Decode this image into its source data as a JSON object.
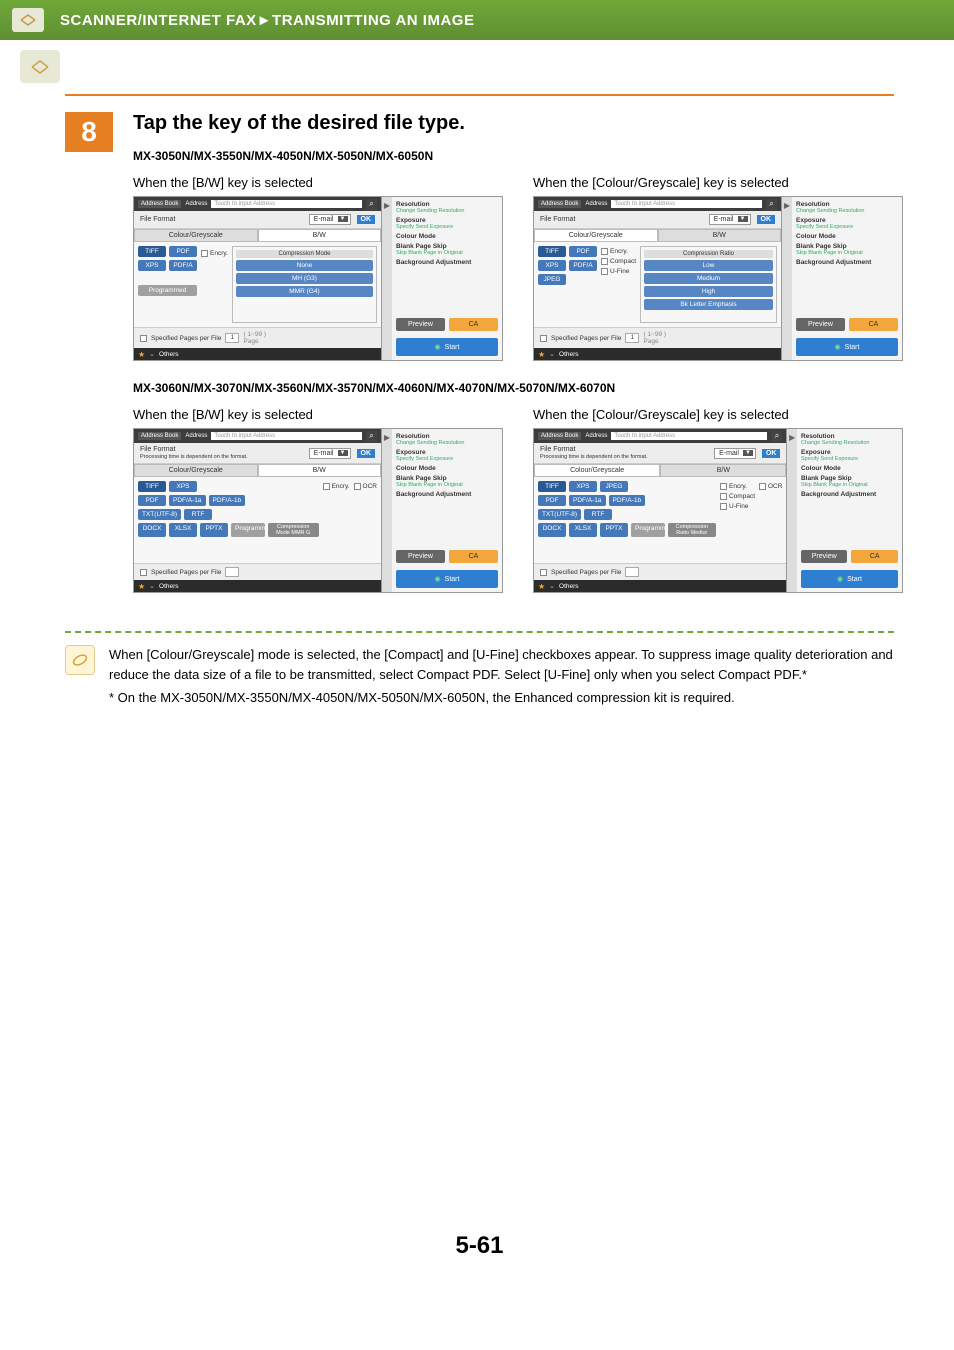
{
  "header": {
    "breadcrumb": "SCANNER/INTERNET FAX►TRANSMITTING AN IMAGE"
  },
  "step": {
    "number": "8",
    "title": "Tap the key of the desired file type."
  },
  "section1": {
    "models": "MX-3050N/MX-3550N/MX-4050N/MX-5050N/MX-6050N",
    "bw_caption": "When the [B/W] key is selected",
    "color_caption": "When the [Colour/Greyscale] key is selected"
  },
  "section2": {
    "models": "MX-3060N/MX-3070N/MX-3560N/MX-3570N/MX-4060N/MX-4070N/MX-5070N/MX-6070N",
    "bw_caption": "When the [B/W] key is selected",
    "color_caption": "When the [Colour/Greyscale] key is selected"
  },
  "mock_common": {
    "address_book": "Address Book",
    "address": "Address",
    "touch_hint": "Touch to input Address",
    "file_format": "File Format",
    "file_format_sub": "Processing time is dependent on the format.",
    "email": "E-mail",
    "ok": "OK",
    "tab_color": "Colour/Greyscale",
    "tab_bw": "B/W",
    "encry": "Encry.",
    "ocr": "OCR",
    "compact": "Compact",
    "ufine": "U-Fine",
    "specified_pages": "Specified Pages per File",
    "one": "1",
    "page_range": "( 1~99 )",
    "page_label": "Page",
    "others": "Others",
    "preview": "Preview",
    "ca": "CA",
    "start": "Start",
    "programmed": "Programmed",
    "comp_mode": "Compression Mode",
    "comp_mode_badge": "Compression Mode MMR G",
    "comp_ratio_badge": "Compression Ratio Mediur",
    "comp_ratio": "Compression Ratio",
    "none": "None",
    "mh": "MH (G3)",
    "mmr": "MMR (G4)",
    "low": "Low",
    "medium": "Medium",
    "high": "High",
    "bk_letter": "Bk Letter Emphasis"
  },
  "filetypes_a": {
    "tiff": "TIFF",
    "pdf": "PDF",
    "xps": "XPS",
    "pdfa": "PDF/A",
    "jpeg": "JPEG"
  },
  "filetypes_b": {
    "tiff": "TIFF",
    "xps": "XPS",
    "jpeg": "JPEG",
    "pdf": "PDF",
    "pdfa1a": "PDF/A-1a",
    "pdfa1b": "PDF/A-1b",
    "txt": "TXT(UTF-8)",
    "rtf": "RTF",
    "docx": "DOCX",
    "xlsx": "XLSX",
    "pptx": "PPTX"
  },
  "rightpanel": {
    "resolution": "Resolution",
    "resolution_sub": "Change Sending Resolution",
    "exposure": "Exposure",
    "exposure_sub": "Specify Send Exposure",
    "colour_mode": "Colour Mode",
    "blank_page": "Blank Page Skip",
    "blank_page_sub": "Skip Blank Page in Original",
    "bg_adjust": "Background Adjustment"
  },
  "note": {
    "body": "When [Colour/Greyscale] mode is selected, the [Compact] and [U-Fine] checkboxes appear. To suppress image quality deterioration and reduce the data size of a file to be transmitted, select Compact PDF. Select [U-Fine] only when you select Compact PDF.*",
    "foot": "*   On the MX-3050N/MX-3550N/MX-4050N/MX-5050N/MX-6050N, the Enhanced compression kit is required."
  },
  "page_number": "5-61"
}
